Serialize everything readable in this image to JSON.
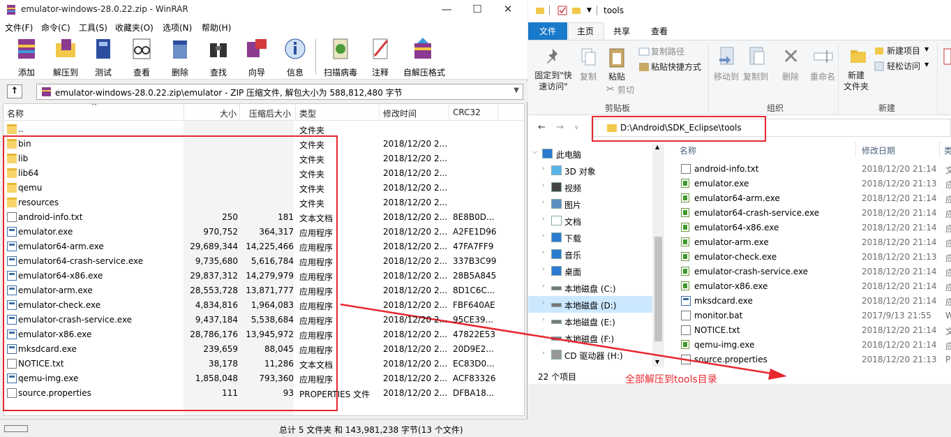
{
  "winrar": {
    "title": "emulator-windows-28.0.22.zip - WinRAR",
    "menu": [
      "文件(F)",
      "命令(C)",
      "工具(S)",
      "收藏夹(O)",
      "选项(N)",
      "帮助(H)"
    ],
    "toolbar": [
      "添加",
      "解压到",
      "测试",
      "查看",
      "删除",
      "查找",
      "向导",
      "信息",
      "扫描病毒",
      "注释",
      "自解压格式"
    ],
    "address": "emulator-windows-28.0.22.zip\\emulator - ZIP 压缩文件, 解包大小为 588,812,480 字节",
    "columns": [
      "名称",
      "大小",
      "压缩后大小",
      "类型",
      "修改时间",
      "CRC32"
    ],
    "rows": [
      {
        "name": "..",
        "size": "",
        "packed": "",
        "type": "文件夹",
        "mtime": "",
        "crc": "",
        "icon": "folder"
      },
      {
        "name": "bin",
        "size": "",
        "packed": "",
        "type": "文件夹",
        "mtime": "2018/12/20 2...",
        "crc": "",
        "icon": "folder"
      },
      {
        "name": "lib",
        "size": "",
        "packed": "",
        "type": "文件夹",
        "mtime": "2018/12/20 2...",
        "crc": "",
        "icon": "folder"
      },
      {
        "name": "lib64",
        "size": "",
        "packed": "",
        "type": "文件夹",
        "mtime": "2018/12/20 2...",
        "crc": "",
        "icon": "folder"
      },
      {
        "name": "qemu",
        "size": "",
        "packed": "",
        "type": "文件夹",
        "mtime": "2018/12/20 2...",
        "crc": "",
        "icon": "folder"
      },
      {
        "name": "resources",
        "size": "",
        "packed": "",
        "type": "文件夹",
        "mtime": "2018/12/20 2...",
        "crc": "",
        "icon": "folder"
      },
      {
        "name": "android-info.txt",
        "size": "250",
        "packed": "181",
        "type": "文本文档",
        "mtime": "2018/12/20 2...",
        "crc": "8E8B0D...",
        "icon": "txt"
      },
      {
        "name": "emulator.exe",
        "size": "970,752",
        "packed": "364,317",
        "type": "应用程序",
        "mtime": "2018/12/20 2...",
        "crc": "A2FE1D96",
        "icon": "exe"
      },
      {
        "name": "emulator64-arm.exe",
        "size": "29,689,344",
        "packed": "14,225,466",
        "type": "应用程序",
        "mtime": "2018/12/20 2...",
        "crc": "47FA7FF9",
        "icon": "exe"
      },
      {
        "name": "emulator64-crash-service.exe",
        "size": "9,735,680",
        "packed": "5,616,784",
        "type": "应用程序",
        "mtime": "2018/12/20 2...",
        "crc": "337B3C99",
        "icon": "exe"
      },
      {
        "name": "emulator64-x86.exe",
        "size": "29,837,312",
        "packed": "14,279,979",
        "type": "应用程序",
        "mtime": "2018/12/20 2...",
        "crc": "28B5A845",
        "icon": "exe"
      },
      {
        "name": "emulator-arm.exe",
        "size": "28,553,728",
        "packed": "13,871,777",
        "type": "应用程序",
        "mtime": "2018/12/20 2...",
        "crc": "8D1C6C...",
        "icon": "exe"
      },
      {
        "name": "emulator-check.exe",
        "size": "4,834,816",
        "packed": "1,964,083",
        "type": "应用程序",
        "mtime": "2018/12/20 2...",
        "crc": "FBF640AE",
        "icon": "exe"
      },
      {
        "name": "emulator-crash-service.exe",
        "size": "9,437,184",
        "packed": "5,538,684",
        "type": "应用程序",
        "mtime": "2018/12/20 2...",
        "crc": "95CE39...",
        "icon": "exe"
      },
      {
        "name": "emulator-x86.exe",
        "size": "28,786,176",
        "packed": "13,945,972",
        "type": "应用程序",
        "mtime": "2018/12/20 2...",
        "crc": "47822E53",
        "icon": "exe"
      },
      {
        "name": "mksdcard.exe",
        "size": "239,659",
        "packed": "88,045",
        "type": "应用程序",
        "mtime": "2018/12/20 2...",
        "crc": "20D9E2...",
        "icon": "exe"
      },
      {
        "name": "NOTICE.txt",
        "size": "38,178",
        "packed": "11,286",
        "type": "文本文档",
        "mtime": "2018/12/20 2...",
        "crc": "EC83D0...",
        "icon": "txt"
      },
      {
        "name": "qemu-img.exe",
        "size": "1,858,048",
        "packed": "793,360",
        "type": "应用程序",
        "mtime": "2018/12/20 2...",
        "crc": "ACF83326",
        "icon": "exe"
      },
      {
        "name": "source.properties",
        "size": "111",
        "packed": "93",
        "type": "PROPERTIES 文件",
        "mtime": "2018/12/20 2...",
        "crc": "DFBA18...",
        "icon": "txt"
      }
    ],
    "status": "总计 5 文件夹 和 143,981,238 字节(13 个文件)"
  },
  "explorer": {
    "title": "tools",
    "tabs": {
      "file": "文件",
      "home": "主页",
      "share": "共享",
      "view": "查看"
    },
    "ribbon": {
      "pin": "固定到\"快\n速访问\"",
      "copy": "复制",
      "paste": "粘贴",
      "copy_path": "复制路径",
      "paste_shortcut": "粘贴快捷方式",
      "cut": "剪切",
      "clipboard_group": "剪贴板",
      "move_to": "移动到",
      "copy_to": "复制到",
      "delete": "删除",
      "rename": "重命名",
      "organize_group": "组织",
      "new_folder": "新建\n文件夹",
      "new_item": "新建项目",
      "easy_access": "轻松访问",
      "new_group": "新建"
    },
    "address": "D:\\Android\\SDK_Eclipse\\tools",
    "nav": [
      "此电脑",
      "3D 对象",
      "视频",
      "图片",
      "文档",
      "下载",
      "音乐",
      "桌面",
      "本地磁盘 (C:)",
      "本地磁盘 (D:)",
      "本地磁盘 (E:)",
      "本地磁盘 (F:)",
      "CD 驱动器 (H:)"
    ],
    "columns": [
      "名称",
      "修改日期",
      "类"
    ],
    "files": [
      {
        "name": "android-info.txt",
        "date": "2018/12/20 21:14",
        "t": "文",
        "icon": "txt"
      },
      {
        "name": "emulator.exe",
        "date": "2018/12/20 21:13",
        "t": "应",
        "icon": "gexe"
      },
      {
        "name": "emulator64-arm.exe",
        "date": "2018/12/20 21:14",
        "t": "应",
        "icon": "gexe"
      },
      {
        "name": "emulator64-crash-service.exe",
        "date": "2018/12/20 21:14",
        "t": "应",
        "icon": "gexe"
      },
      {
        "name": "emulator64-x86.exe",
        "date": "2018/12/20 21:14",
        "t": "应",
        "icon": "gexe"
      },
      {
        "name": "emulator-arm.exe",
        "date": "2018/12/20 21:14",
        "t": "应",
        "icon": "gexe"
      },
      {
        "name": "emulator-check.exe",
        "date": "2018/12/20 21:13",
        "t": "应",
        "icon": "gexe"
      },
      {
        "name": "emulator-crash-service.exe",
        "date": "2018/12/20 21:14",
        "t": "应",
        "icon": "gexe"
      },
      {
        "name": "emulator-x86.exe",
        "date": "2018/12/20 21:14",
        "t": "应",
        "icon": "gexe"
      },
      {
        "name": "mksdcard.exe",
        "date": "2018/12/20 21:14",
        "t": "应",
        "icon": "exe"
      },
      {
        "name": "monitor.bat",
        "date": "2017/9/13 21:55",
        "t": "W",
        "icon": "txt"
      },
      {
        "name": "NOTICE.txt",
        "date": "2018/12/20 21:14",
        "t": "文",
        "icon": "txt"
      },
      {
        "name": "qemu-img.exe",
        "date": "2018/12/20 21:14",
        "t": "应",
        "icon": "gexe"
      },
      {
        "name": "source.properties",
        "date": "2018/12/20 21:13",
        "t": "P",
        "icon": "txt"
      }
    ],
    "status": "22 个项目"
  },
  "annotation": "全部解压到tools目录",
  "colors": {
    "annotation": "#e8262f",
    "file_tab": "#1979ca",
    "selected": "#cce8ff"
  }
}
